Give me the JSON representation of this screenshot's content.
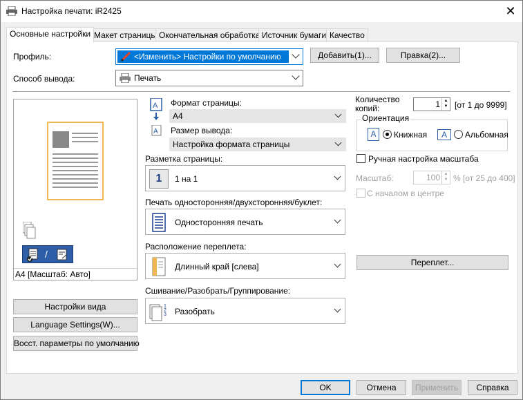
{
  "window": {
    "title": "Настройка печати: iR2425",
    "close_glyph": "✕"
  },
  "tabs": [
    {
      "label": "Основные настройки"
    },
    {
      "label": "Макет страницы"
    },
    {
      "label": "Окончательная обработка"
    },
    {
      "label": "Источник бумаги"
    },
    {
      "label": "Качество"
    }
  ],
  "profile": {
    "label": "Профиль:",
    "value": "<Изменить> Настройки по умолчанию",
    "add_button": "Добавить(1)...",
    "edit_button": "Правка(2)..."
  },
  "output": {
    "label": "Способ вывода:",
    "value": "Печать"
  },
  "preview": {
    "caption": "A4 [Масштаб: Авто]",
    "slash": "/"
  },
  "left_buttons": {
    "view_settings": "Настройки вида",
    "language": "Language Settings(W)...",
    "restore": "Восст. параметры по умолчанию"
  },
  "page_format": {
    "label": "Формат страницы:",
    "value": "A4"
  },
  "output_size": {
    "label": "Размер вывода:",
    "value": "Настройка формата страницы"
  },
  "layout": {
    "label": "Разметка страницы:",
    "value": "1 на 1",
    "icon_text": "1"
  },
  "duplex": {
    "label": "Печать односторонняя/двухсторонняя/буклет:",
    "value": "Односторонняя печать"
  },
  "binding_location": {
    "label": "Расположение переплета:",
    "value": "Длинный край [слева]"
  },
  "collate": {
    "label": "Сшивание/Разобрать/Группирование:",
    "value": "Разобрать"
  },
  "copies": {
    "label_line1": "Количество",
    "label_line2": "копий:",
    "value": "1",
    "range": "[от 1 до 9999]"
  },
  "orientation": {
    "legend": "Ориентация",
    "portrait": "Книжная",
    "landscape": "Альбомная",
    "icon_letter": "A"
  },
  "manual_scale": {
    "label": "Ручная настройка масштаба",
    "scale_label": "Масштаб:",
    "scale_value": "100",
    "scale_range": "% [от 25 до 400]",
    "center_label": "С началом в центре"
  },
  "gutter_button": "Переплет...",
  "footer": {
    "ok": "OK",
    "cancel": "Отмена",
    "apply": "Применить",
    "help": "Справка"
  },
  "colors": {
    "accent": "#0078d7",
    "preview_border": "#f0b74f"
  }
}
